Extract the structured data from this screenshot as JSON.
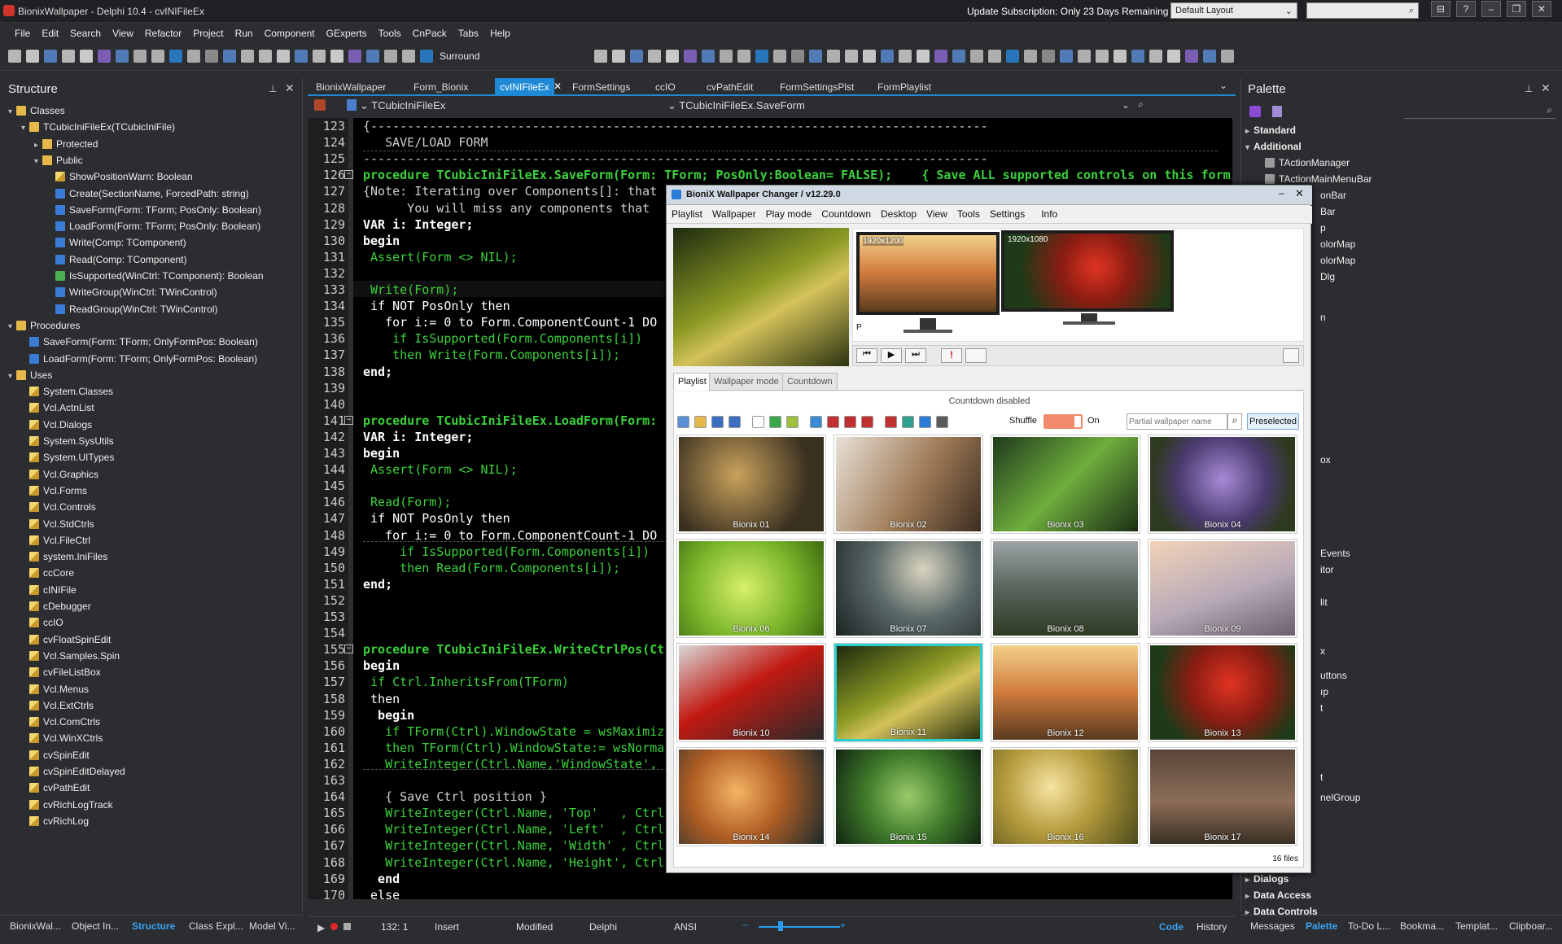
{
  "window": {
    "title": "BionixWallpaper - Delphi 10.4 - cvINIFileEx",
    "update_notice": "Update Subscription: Only 23 Days Remaining",
    "layout": "Default Layout",
    "controls": [
      "⊟",
      "?",
      "–",
      "❐",
      "✕"
    ]
  },
  "menu": [
    "File",
    "Edit",
    "Search",
    "View",
    "Refactor",
    "Project",
    "Run",
    "Component",
    "GExperts",
    "Tools",
    "CnPack",
    "Tabs",
    "Help"
  ],
  "toolbar": {
    "surround_label": "Surround"
  },
  "structure": {
    "title": "Structure",
    "rows": [
      {
        "t": "Classes",
        "d": 0,
        "i": "fold",
        "e": "▾"
      },
      {
        "t": "TCubicIniFileEx(TCubicIniFile)",
        "d": 1,
        "i": "fold",
        "e": "▾"
      },
      {
        "t": "Protected",
        "d": 2,
        "i": "fold",
        "e": "▸"
      },
      {
        "t": "Public",
        "d": 2,
        "i": "fold",
        "e": "▾"
      },
      {
        "t": "ShowPositionWarn: Boolean",
        "d": 3,
        "i": "unit",
        "e": ""
      },
      {
        "t": "Create(SectionName, ForcedPath: string)",
        "d": 3,
        "i": "meth",
        "e": ""
      },
      {
        "t": "SaveForm(Form: TForm; PosOnly: Boolean)",
        "d": 3,
        "i": "meth",
        "e": ""
      },
      {
        "t": "LoadForm(Form: TForm; PosOnly: Boolean)",
        "d": 3,
        "i": "meth",
        "e": ""
      },
      {
        "t": "Write(Comp: TComponent)",
        "d": 3,
        "i": "meth",
        "e": ""
      },
      {
        "t": "Read(Comp: TComponent)",
        "d": 3,
        "i": "meth",
        "e": ""
      },
      {
        "t": "IsSupported(WinCtrl: TComponent): Boolean",
        "d": 3,
        "i": "methg",
        "e": ""
      },
      {
        "t": "WriteGroup(WinCtrl: TWinControl)",
        "d": 3,
        "i": "meth",
        "e": ""
      },
      {
        "t": "ReadGroup(WinCtrl: TWinControl)",
        "d": 3,
        "i": "meth",
        "e": ""
      },
      {
        "t": "Procedures",
        "d": 0,
        "i": "fold",
        "e": "▾"
      },
      {
        "t": "SaveForm(Form: TForm; OnlyFormPos: Boolean)",
        "d": 1,
        "i": "meth",
        "e": ""
      },
      {
        "t": "LoadForm(Form: TForm; OnlyFormPos: Boolean)",
        "d": 1,
        "i": "meth",
        "e": ""
      },
      {
        "t": "Uses",
        "d": 0,
        "i": "fold",
        "e": "▾"
      },
      {
        "t": "System.Classes",
        "d": 1,
        "i": "unit",
        "e": ""
      },
      {
        "t": "Vcl.ActnList",
        "d": 1,
        "i": "unit",
        "e": ""
      },
      {
        "t": "Vcl.Dialogs",
        "d": 1,
        "i": "unit",
        "e": ""
      },
      {
        "t": "System.SysUtils",
        "d": 1,
        "i": "unit",
        "e": ""
      },
      {
        "t": "System.UITypes",
        "d": 1,
        "i": "unit",
        "e": ""
      },
      {
        "t": "Vcl.Graphics",
        "d": 1,
        "i": "unit",
        "e": ""
      },
      {
        "t": "Vcl.Forms",
        "d": 1,
        "i": "unit",
        "e": ""
      },
      {
        "t": "Vcl.Controls",
        "d": 1,
        "i": "unit",
        "e": ""
      },
      {
        "t": "Vcl.StdCtrls",
        "d": 1,
        "i": "unit",
        "e": ""
      },
      {
        "t": "Vcl.FileCtrl",
        "d": 1,
        "i": "unit",
        "e": ""
      },
      {
        "t": "system.IniFiles",
        "d": 1,
        "i": "unit",
        "e": ""
      },
      {
        "t": "ccCore",
        "d": 1,
        "i": "unit",
        "e": ""
      },
      {
        "t": "cINIFile",
        "d": 1,
        "i": "unit",
        "e": ""
      },
      {
        "t": "cDebugger",
        "d": 1,
        "i": "unit",
        "e": ""
      },
      {
        "t": "ccIO",
        "d": 1,
        "i": "unit",
        "e": ""
      },
      {
        "t": "cvFloatSpinEdit",
        "d": 1,
        "i": "unit",
        "e": ""
      },
      {
        "t": "Vcl.Samples.Spin",
        "d": 1,
        "i": "unit",
        "e": ""
      },
      {
        "t": "cvFileListBox",
        "d": 1,
        "i": "unit",
        "e": ""
      },
      {
        "t": "Vcl.Menus",
        "d": 1,
        "i": "unit",
        "e": ""
      },
      {
        "t": "Vcl.ExtCtrls",
        "d": 1,
        "i": "unit",
        "e": ""
      },
      {
        "t": "Vcl.ComCtrls",
        "d": 1,
        "i": "unit",
        "e": ""
      },
      {
        "t": "Vcl.WinXCtrls",
        "d": 1,
        "i": "unit",
        "e": ""
      },
      {
        "t": "cvSpinEdit",
        "d": 1,
        "i": "unit",
        "e": ""
      },
      {
        "t": "cvSpinEditDelayed",
        "d": 1,
        "i": "unit",
        "e": ""
      },
      {
        "t": "cvPathEdit",
        "d": 1,
        "i": "unit",
        "e": ""
      },
      {
        "t": "cvRichLogTrack",
        "d": 1,
        "i": "unit",
        "e": ""
      },
      {
        "t": "cvRichLog",
        "d": 1,
        "i": "unit",
        "e": ""
      }
    ]
  },
  "left_tabs": [
    "BionixWal...",
    "Object In...",
    "Structure",
    "Class Expl...",
    "Model Vi..."
  ],
  "editor": {
    "tabs": [
      "BionixWallpaper",
      "Form_Bionix",
      "cvINIFileEx",
      "FormSettings",
      "ccIO",
      "cvPathEdit",
      "FormSettingsPlst",
      "FormPlaylist"
    ],
    "active_tab": 2,
    "class_combo": "TCubicIniFileEx",
    "method_combo": "TCubicIniFileEx.SaveForm"
  },
  "code": [
    {
      "n": "123",
      "t": "{------------------------------------------------------------------------------------",
      "c": "#cfcfcf"
    },
    {
      "n": "124",
      "t": "   SAVE/LOAD FORM",
      "c": "#cfcfcf"
    },
    {
      "n": "125",
      "t": "-------------------------------------------------------------------------------------",
      "c": "#cfcfcf"
    },
    {
      "n": "126",
      "t": "procedure TCubicIniFileEx.SaveForm(Form: TForm; PosOnly:Boolean= FALSE);    { Save ALL supported controls on this form",
      "c": "#3bd23b",
      "f": true
    },
    {
      "n": "127",
      "t": "{Note: Iterating over Components[]: that",
      "c": "#cfcfcf"
    },
    {
      "n": "128",
      "t": "      You will miss any components that",
      "c": "#cfcfcf"
    },
    {
      "n": "129",
      "t": "VAR i: Integer;",
      "c": "#ffffff"
    },
    {
      "n": "130",
      "t": "begin",
      "c": "#ffffff"
    },
    {
      "n": "131",
      "t": " Assert(Form <> NIL);",
      "c": "#3bd23b"
    },
    {
      "n": "132",
      "t": "",
      "c": "#ffffff"
    },
    {
      "n": "133",
      "t": " Write(Form);",
      "c": "#3bd23b"
    },
    {
      "n": "134",
      "t": " if NOT PosOnly then",
      "c": "#ffffff"
    },
    {
      "n": "135",
      "t": "   for i:= 0 to Form.ComponentCount-1 DO",
      "c": "#ffffff"
    },
    {
      "n": "136",
      "t": "    if IsSupported(Form.Components[i])",
      "c": "#3bd23b"
    },
    {
      "n": "137",
      "t": "    then Write(Form.Components[i]);",
      "c": "#3bd23b"
    },
    {
      "n": "138",
      "t": "end;",
      "c": "#ffffff"
    },
    {
      "n": "139",
      "t": "",
      "c": "#ffffff"
    },
    {
      "n": "140",
      "t": "",
      "c": "#ffffff"
    },
    {
      "n": "141",
      "t": "procedure TCubicIniFileEx.LoadForm(Form:",
      "c": "#3bd23b",
      "f": true
    },
    {
      "n": "142",
      "t": "VAR i: Integer;",
      "c": "#ffffff"
    },
    {
      "n": "143",
      "t": "begin",
      "c": "#ffffff"
    },
    {
      "n": "144",
      "t": " Assert(Form <> NIL);",
      "c": "#3bd23b"
    },
    {
      "n": "145",
      "t": "",
      "c": "#ffffff"
    },
    {
      "n": "146",
      "t": " Read(Form);",
      "c": "#3bd23b"
    },
    {
      "n": "147",
      "t": " if NOT PosOnly then",
      "c": "#ffffff"
    },
    {
      "n": "148",
      "t": "   for i:= 0 to Form.ComponentCount-1 DO",
      "c": "#ffffff"
    },
    {
      "n": "149",
      "t": "     if IsSupported(Form.Components[i])",
      "c": "#3bd23b"
    },
    {
      "n": "150",
      "t": "     then Read(Form.Components[i]);",
      "c": "#3bd23b"
    },
    {
      "n": "151",
      "t": "end;",
      "c": "#ffffff"
    },
    {
      "n": "152",
      "t": "",
      "c": "#ffffff"
    },
    {
      "n": "153",
      "t": "",
      "c": "#ffffff"
    },
    {
      "n": "154",
      "t": "",
      "c": "#ffffff"
    },
    {
      "n": "155",
      "t": "procedure TCubicIniFileEx.WriteCtrlPos(Ct",
      "c": "#3bd23b",
      "f": true
    },
    {
      "n": "156",
      "t": "begin",
      "c": "#ffffff"
    },
    {
      "n": "157",
      "t": " if Ctrl.InheritsFrom(TForm)",
      "c": "#3bd23b"
    },
    {
      "n": "158",
      "t": " then",
      "c": "#ffffff"
    },
    {
      "n": "159",
      "t": "  begin",
      "c": "#ffffff"
    },
    {
      "n": "160",
      "t": "   if TForm(Ctrl).WindowState = wsMaximiz",
      "c": "#3bd23b"
    },
    {
      "n": "161",
      "t": "   then TForm(Ctrl).WindowState:= wsNorma",
      "c": "#3bd23b"
    },
    {
      "n": "162",
      "t": "   WriteInteger(Ctrl.Name,'WindowState', ",
      "c": "#3bd23b"
    },
    {
      "n": "163",
      "t": "",
      "c": "#ffffff"
    },
    {
      "n": "164",
      "t": "   { Save Ctrl position }",
      "c": "#cfcfcf"
    },
    {
      "n": "165",
      "t": "   WriteInteger(Ctrl.Name, 'Top'   , Ctrl",
      "c": "#3bd23b"
    },
    {
      "n": "166",
      "t": "   WriteInteger(Ctrl.Name, 'Left'  , Ctrl",
      "c": "#3bd23b"
    },
    {
      "n": "167",
      "t": "   WriteInteger(Ctrl.Name, 'Width' , Ctrl",
      "c": "#3bd23b"
    },
    {
      "n": "168",
      "t": "   WriteInteger(Ctrl.Name, 'Height', Ctrl",
      "c": "#3bd23b"
    },
    {
      "n": "169",
      "t": "  end",
      "c": "#ffffff"
    },
    {
      "n": "170",
      "t": " else",
      "c": "#ffffff"
    }
  ],
  "status": {
    "position": "132:  1",
    "mode": "Insert",
    "modified": "Modified",
    "language": "Delphi",
    "encoding": "ANSI",
    "code_tab": "Code",
    "history_tab": "History"
  },
  "palette": {
    "title": "Palette",
    "rows": [
      {
        "t": "Standard",
        "b": true,
        "e": "▸",
        "d": 0
      },
      {
        "t": "Additional",
        "b": true,
        "e": "▾",
        "d": 0
      },
      {
        "t": "TActionManager",
        "b": false,
        "e": "",
        "d": 1
      },
      {
        "t": "TActionMainMenuBar",
        "b": false,
        "e": "",
        "d": 1
      },
      {
        "t": "Dialogs",
        "b": true,
        "e": "▸",
        "d": 0
      },
      {
        "t": "Data Access",
        "b": true,
        "e": "▸",
        "d": 0
      },
      {
        "t": "Data Controls",
        "b": true,
        "e": "▸",
        "d": 0
      }
    ],
    "partial_labels": [
      "onBar",
      "Bar",
      "p",
      "olorMap",
      "olorMap",
      "Dlg",
      "n",
      "ox",
      "Events",
      "itor",
      "lit",
      "x",
      "uttons",
      "ıp",
      "t",
      "t",
      "nelGroup"
    ]
  },
  "right_tabs": [
    "Messages",
    "Palette",
    "To-Do L...",
    "Bookma...",
    "Templat...",
    "Clipboar..."
  ],
  "bionix": {
    "title": "BioniX Wallpaper Changer /  v12.29.0",
    "menu": [
      "Playlist",
      "Wallpaper",
      "Play mode",
      "Countdown",
      "Desktop",
      "View",
      "Tools",
      "Settings",
      "Info"
    ],
    "monitors": [
      {
        "res": "1920x1200",
        "num": "P"
      },
      {
        "res": "1920x1080",
        "num": ""
      }
    ],
    "tabs": [
      "Playlist",
      "Wallpaper mode",
      "Countdown"
    ],
    "countdown": "Countdown disabled",
    "shuffle_label": "Shuffle",
    "on_label": "On",
    "search_placeholder": "Partial wallpaper name",
    "preselected": "Preselected",
    "files_count": "16 files",
    "thumbs": [
      {
        "cap": "Bionix 01",
        "bg": "radial-gradient(circle at 40% 40%,#c9a25c,#3a3020 70%)"
      },
      {
        "cap": "Bionix 02",
        "bg": "linear-gradient(120deg,#e8e0d6 0%,#9e7a56 55%,#3b2c20 100%)"
      },
      {
        "cap": "Bionix 03",
        "bg": "linear-gradient(135deg,#1f3a1c 0%,#6fae3c 50%,#1a2e14 100%)"
      },
      {
        "cap": "Bionix 04",
        "bg": "radial-gradient(circle at 50% 45%,#a68ad6,#4a3a6e 50%,#2e3a20 80%)"
      },
      {
        "cap": "Bionix 06",
        "bg": "radial-gradient(circle at 45% 50%,#d8ef6a,#7ab62a 55%,#3e6a12 100%)"
      },
      {
        "cap": "Bionix 07",
        "bg": "radial-gradient(circle at 60% 30%,#d9d4bf,#5c6a6a 45%,#1c2222 100%)"
      },
      {
        "cap": "Bionix 08",
        "bg": "linear-gradient(180deg,#9ea4a6 0%,#5d6a62 45%,#2e3a22 100%)"
      },
      {
        "cap": "Bionix 09",
        "bg": "linear-gradient(160deg,#f2d3b8 0%,#b9aab8 55%,#6d5e6e 100%)"
      },
      {
        "cap": "Bionix 10",
        "bg": "linear-gradient(150deg,#d8d8d8 0%,#c21a12 45%,#2a2a2a 100%)"
      },
      {
        "cap": "Bionix 11",
        "bg": "linear-gradient(150deg,#1d2a10 0%,#8c9a24 45%,#d4c25a 60%,#2a3210 100%)"
      },
      {
        "cap": "Bionix 12",
        "bg": "linear-gradient(180deg,#f2d08a 0%,#d07a3c 50%,#5a3a1e 100%)"
      },
      {
        "cap": "Bionix 13",
        "bg": "radial-gradient(circle at 55% 40%,#e03422,#8a1c12 40%,#1f3a18 75%)"
      },
      {
        "cap": "Bionix 14",
        "bg": "radial-gradient(circle at 40% 45%,#f5b464,#b05e24 45%,#1a2a2e 100%)"
      },
      {
        "cap": "Bionix 15",
        "bg": "radial-gradient(circle at 50% 50%,#9acb6a,#3e7a2a 50%,#122412 100%)"
      },
      {
        "cap": "Bionix 16",
        "bg": "radial-gradient(circle at 40% 40%,#f7e4a2,#b49a3c 45%,#4a4a1a 100%)"
      },
      {
        "cap": "Bionix 17",
        "bg": "linear-gradient(180deg,#5a4638 0%,#8c6e58 55%,#3a2e24 100%)"
      }
    ]
  }
}
